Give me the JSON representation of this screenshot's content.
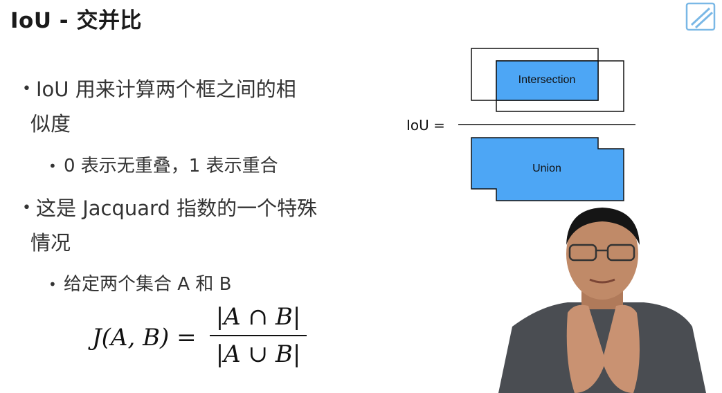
{
  "title": "IoU - 交并比",
  "bullets": [
    {
      "text_line1": "IoU 用来计算两个框之间的相",
      "text_line2": "似度"
    },
    {
      "sub": "0 表示无重叠，1 表示重合"
    },
    {
      "text_line1": "这是 Jacquard 指数的一个特殊",
      "text_line2": "情况"
    },
    {
      "sub": "给定两个集合 A 和 B"
    }
  ],
  "formula": {
    "lhs": "J(A, B) =",
    "numerator": "|A ∩ B|",
    "denominator": "|A ∪ B|"
  },
  "diagram": {
    "iou_label": "IoU =",
    "intersection_label": "Intersection",
    "union_label": "Union",
    "fill_color": "#4da6f5",
    "stroke_color": "#111111"
  },
  "bullet_glyph": "•",
  "watermark_icon": "bilibili-tv-icon"
}
